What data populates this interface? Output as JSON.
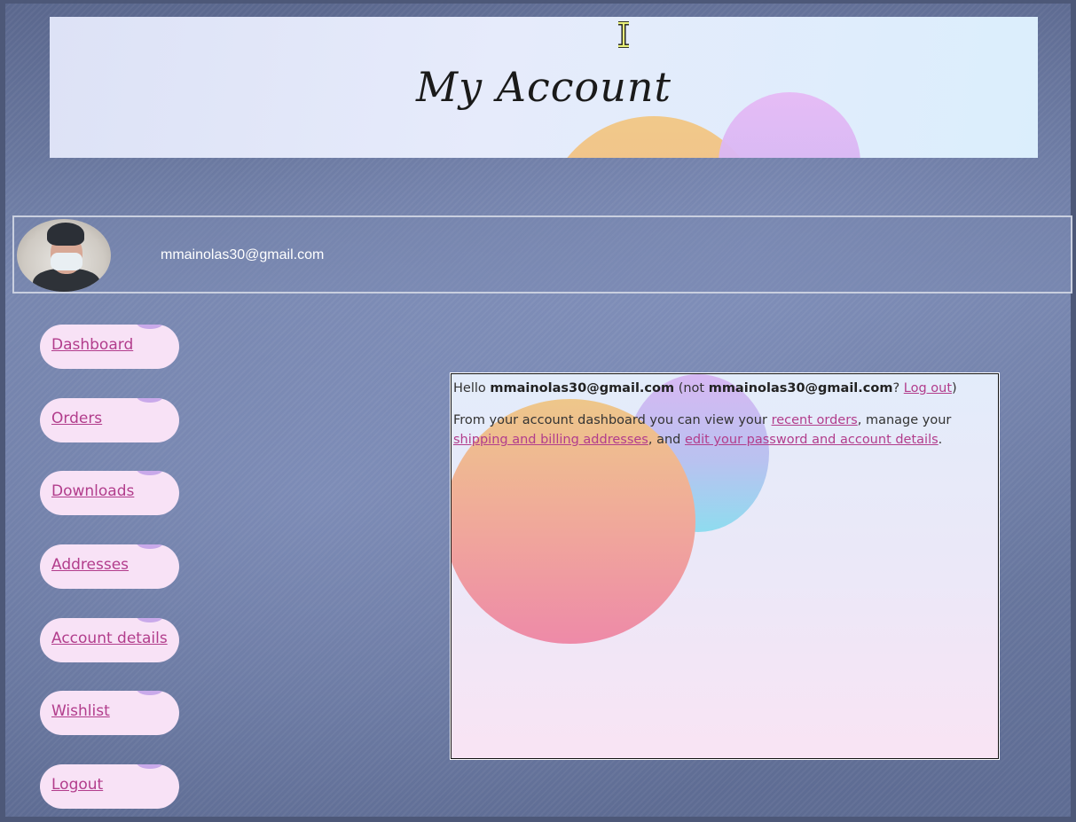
{
  "banner": {
    "title": "My Account"
  },
  "profile": {
    "email": "mmainolas30@gmail.com"
  },
  "nav": {
    "items": [
      {
        "label": "Dashboard"
      },
      {
        "label": "Orders"
      },
      {
        "label": "Downloads"
      },
      {
        "label": "Addresses"
      },
      {
        "label": "Account details"
      },
      {
        "label": "Wishlist"
      },
      {
        "label": "Logout"
      }
    ]
  },
  "content": {
    "hello": "Hello",
    "user": "mmainolas30@gmail.com",
    "not_open": "(not",
    "user_again": "mmainolas30@gmail.com",
    "question": "?",
    "logout_link": "Log out",
    "close_paren": ")",
    "intro": "From your account dashboard you can view your",
    "recent_orders_link": "recent orders",
    "manage": ", manage your",
    "addresses_link": "shipping and billing addresses",
    "and": ", and",
    "account_link": "edit your password and account details",
    "period": "."
  },
  "colors": {
    "link": "#b23d8c",
    "nav_pill": "#f8e2f6",
    "page_bg": "#5d6a90"
  },
  "icons": {
    "cursor": "text-cursor-icon"
  }
}
